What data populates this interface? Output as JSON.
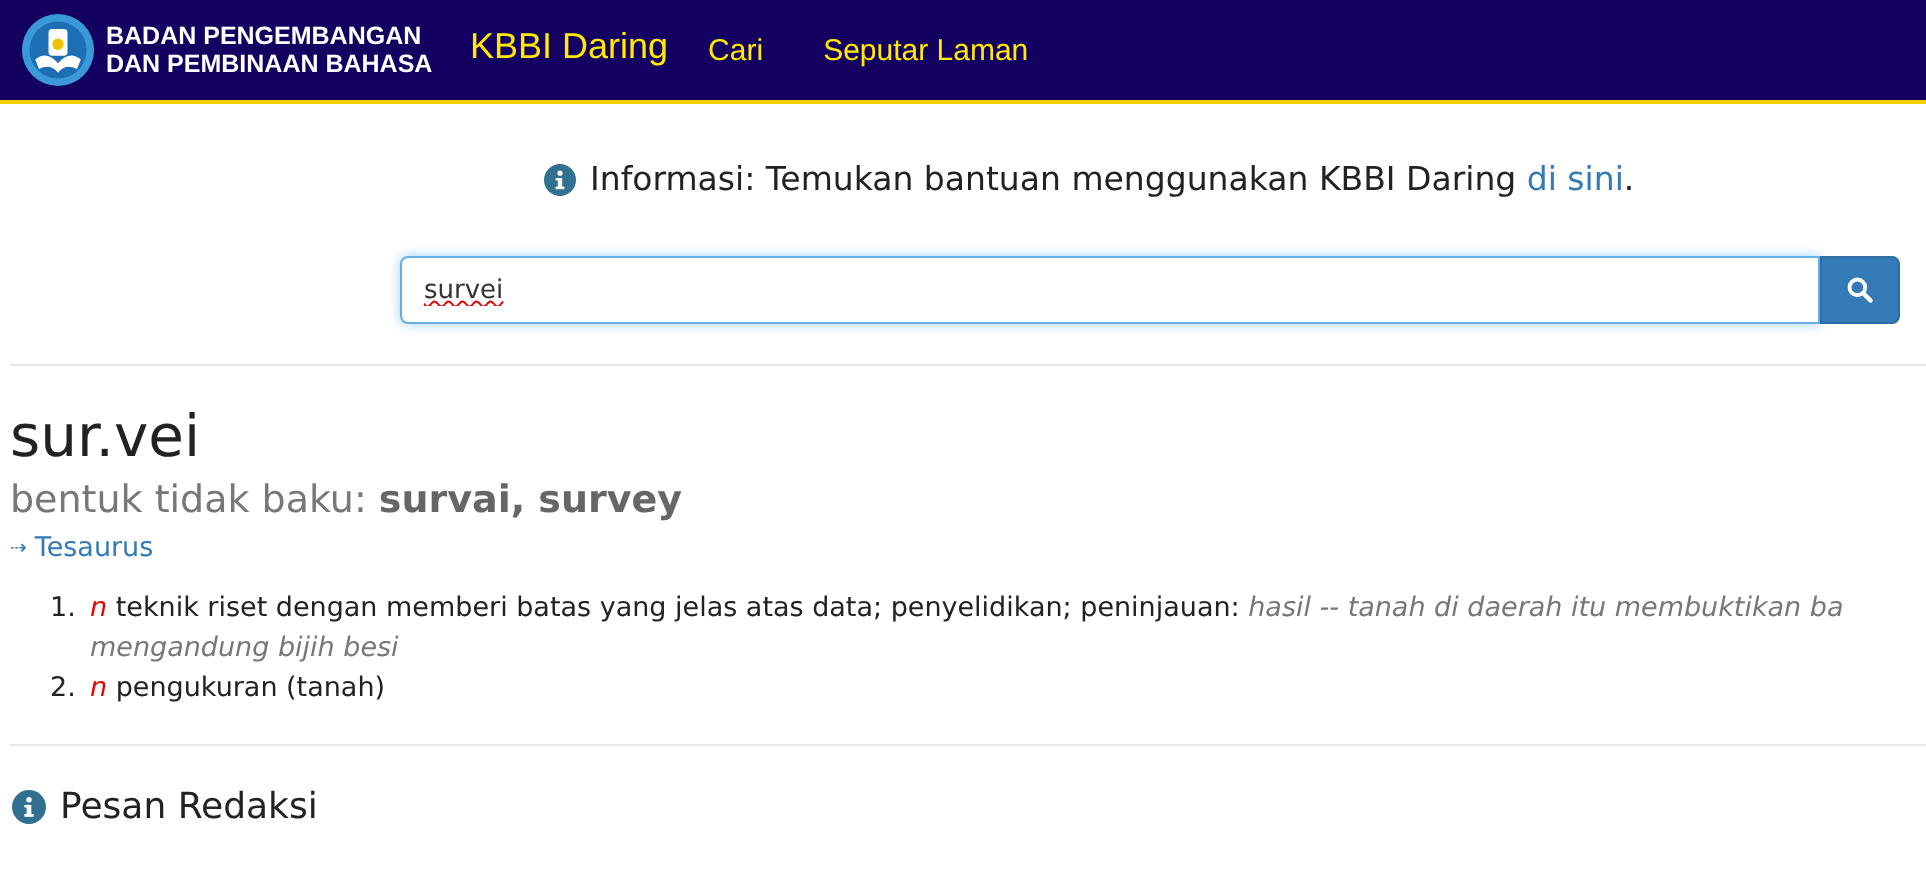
{
  "header": {
    "org_name": [
      "BADAN PENGEMBANGAN",
      "DAN PEMBINAAN BAHASA"
    ],
    "nav": [
      {
        "label": "KBBI Daring",
        "kind": "brand"
      },
      {
        "label": "Cari",
        "kind": "link"
      },
      {
        "label": "Seputar Laman",
        "kind": "link"
      }
    ]
  },
  "info": {
    "text": "Informasi: Temukan bantuan menggunakan KBBI Daring ",
    "link": "di sini",
    "end": "."
  },
  "search": {
    "value": "survei"
  },
  "entry": {
    "headword": "sur.vei",
    "variant_label": "bentuk tidak baku: ",
    "variants": "survai, survey",
    "thesaurus_arrow": "⇢",
    "thesaurus": "Tesaurus",
    "senses": [
      {
        "number": "1.",
        "pos": "n",
        "definition": "teknik riset dengan memberi batas yang jelas atas data; penyelidikan; peninjauan:",
        "example": [
          "hasil -- tanah di daerah itu membuktikan ba",
          "mengandung bijih besi"
        ]
      },
      {
        "number": "2.",
        "pos": "n",
        "definition": "pengukuran (tanah)"
      }
    ]
  },
  "section": {
    "title": "Pesan Redaksi"
  }
}
